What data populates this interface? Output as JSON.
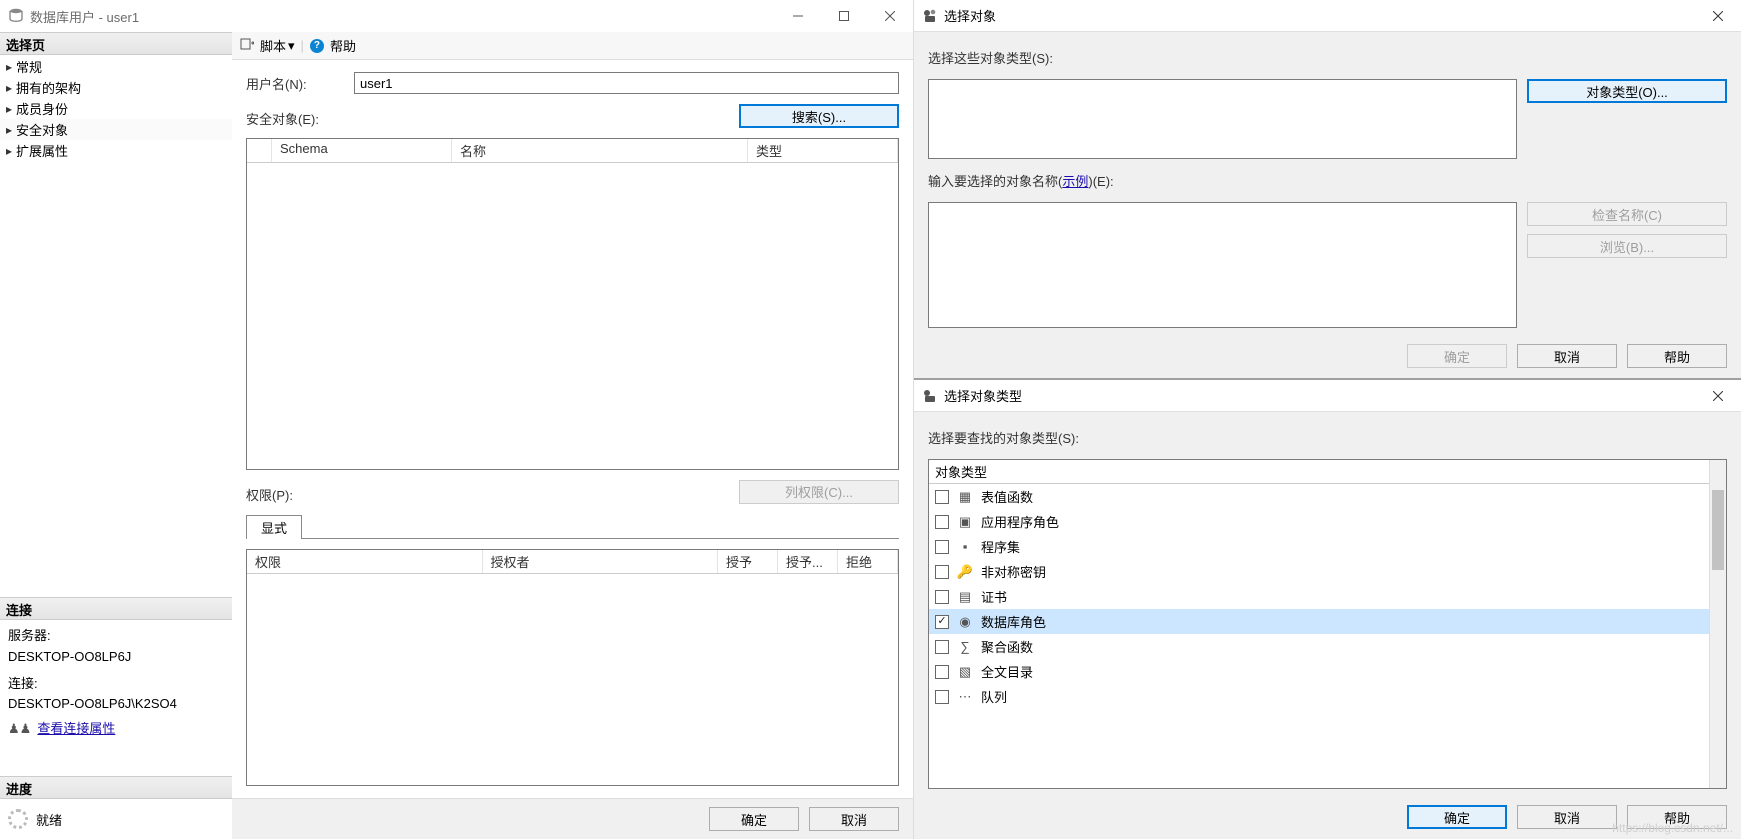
{
  "main": {
    "title": "数据库用户 - user1",
    "sidebar": {
      "header_pages": "选择页",
      "pages": [
        "常规",
        "拥有的架构",
        "成员身份",
        "安全对象",
        "扩展属性"
      ],
      "selected_index": 3,
      "header_conn": "连接",
      "server_label": "服务器:",
      "server_value": "DESKTOP-OO8LP6J",
      "conn_label": "连接:",
      "conn_value": "DESKTOP-OO8LP6J\\K2SO4",
      "conn_link": "查看连接属性",
      "header_progress": "进度",
      "progress_text": "就绪"
    },
    "toolbar": {
      "script": "脚本",
      "help": "帮助"
    },
    "form": {
      "username_label": "用户名(N):",
      "username_value": "user1",
      "securables_label": "安全对象(E):",
      "search_btn": "搜索(S)...",
      "cols": {
        "schema": "Schema",
        "name": "名称",
        "type": "类型"
      },
      "perm_label": "权限(P):",
      "colperm_btn": "列权限(C)...",
      "tab_explicit": "显式",
      "perm_cols": {
        "perm": "权限",
        "grantor": "授权者",
        "grant": "授予",
        "grantw": "授予...",
        "deny": "拒绝"
      }
    },
    "footer": {
      "ok": "确定",
      "cancel": "取消"
    }
  },
  "dlg_select": {
    "title": "选择对象",
    "types_label": "选择这些对象类型(S):",
    "types_btn": "对象类型(O)...",
    "names_label_pre": "输入要选择的对象名称(",
    "names_label_link": "示例",
    "names_label_post": ")(E):",
    "check_btn": "检查名称(C)",
    "browse_btn": "浏览(B)...",
    "ok": "确定",
    "cancel": "取消",
    "help": "帮助"
  },
  "dlg_types": {
    "title": "选择对象类型",
    "instr": "选择要查找的对象类型(S):",
    "col_header": "对象类型",
    "items": [
      {
        "label": "表值函数",
        "checked": false
      },
      {
        "label": "应用程序角色",
        "checked": false
      },
      {
        "label": "程序集",
        "checked": false
      },
      {
        "label": "非对称密钥",
        "checked": false
      },
      {
        "label": "证书",
        "checked": false
      },
      {
        "label": "数据库角色",
        "checked": true
      },
      {
        "label": "聚合函数",
        "checked": false
      },
      {
        "label": "全文目录",
        "checked": false
      },
      {
        "label": "队列",
        "checked": false
      }
    ],
    "ok": "确定",
    "cancel": "取消",
    "help": "帮助"
  }
}
